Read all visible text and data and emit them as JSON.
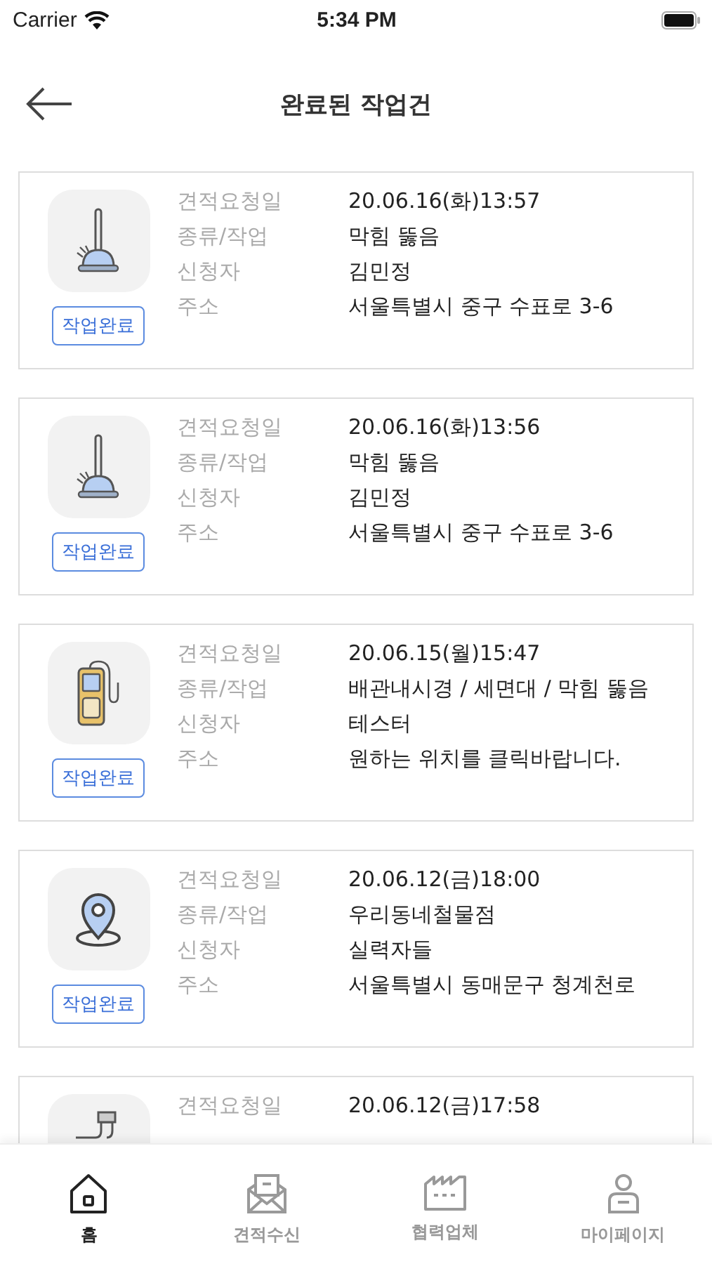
{
  "status_bar": {
    "carrier": "Carrier",
    "time": "5:34 PM"
  },
  "header": {
    "title": "완료된 작업건"
  },
  "jobs": [
    {
      "kind": "plunger",
      "status": "작업완료",
      "rows": [
        {
          "label": "견적요청일",
          "value": "20.06.16(화)13:57"
        },
        {
          "label": "종류/작업",
          "value": "막힘 뚫음"
        },
        {
          "label": "신청자",
          "value": "김민정"
        },
        {
          "label": "주소",
          "value": "서울특별시 중구 수표로 3-6"
        }
      ]
    },
    {
      "kind": "plunger",
      "status": "작업완료",
      "rows": [
        {
          "label": "견적요청일",
          "value": "20.06.16(화)13:56"
        },
        {
          "label": "종류/작업",
          "value": "막힘 뚫음"
        },
        {
          "label": "신청자",
          "value": "김민정"
        },
        {
          "label": "주소",
          "value": "서울특별시 중구 수표로 3-6"
        }
      ]
    },
    {
      "kind": "meter",
      "status": "작업완료",
      "rows": [
        {
          "label": "견적요청일",
          "value": "20.06.15(월)15:47"
        },
        {
          "label": "종류/작업",
          "value": "배관내시경 / 세면대 / 막힘 뚫음"
        },
        {
          "label": "신청자",
          "value": "테스터"
        },
        {
          "label": "주소",
          "value": "원하는 위치를 클릭바랍니다."
        }
      ]
    },
    {
      "kind": "pin",
      "status": "작업완료",
      "rows": [
        {
          "label": "견적요청일",
          "value": "20.06.12(금)18:00"
        },
        {
          "label": "종류/작업",
          "value": "우리동네철물점"
        },
        {
          "label": "신청자",
          "value": "실력자들"
        },
        {
          "label": "주소",
          "value": "서울특별시 동매문구 청계천로"
        }
      ]
    },
    {
      "kind": "pipe",
      "rows": [
        {
          "label": "견적요청일",
          "value": "20.06.12(금)17:58"
        }
      ]
    }
  ],
  "tab_bar": [
    {
      "kind": "home",
      "label": "홈",
      "selected": true
    },
    {
      "kind": "mail",
      "label": "견적수신",
      "selected": false
    },
    {
      "kind": "factory",
      "label": "협력업체",
      "selected": false
    },
    {
      "kind": "person",
      "label": "마이페이지",
      "selected": false
    }
  ]
}
